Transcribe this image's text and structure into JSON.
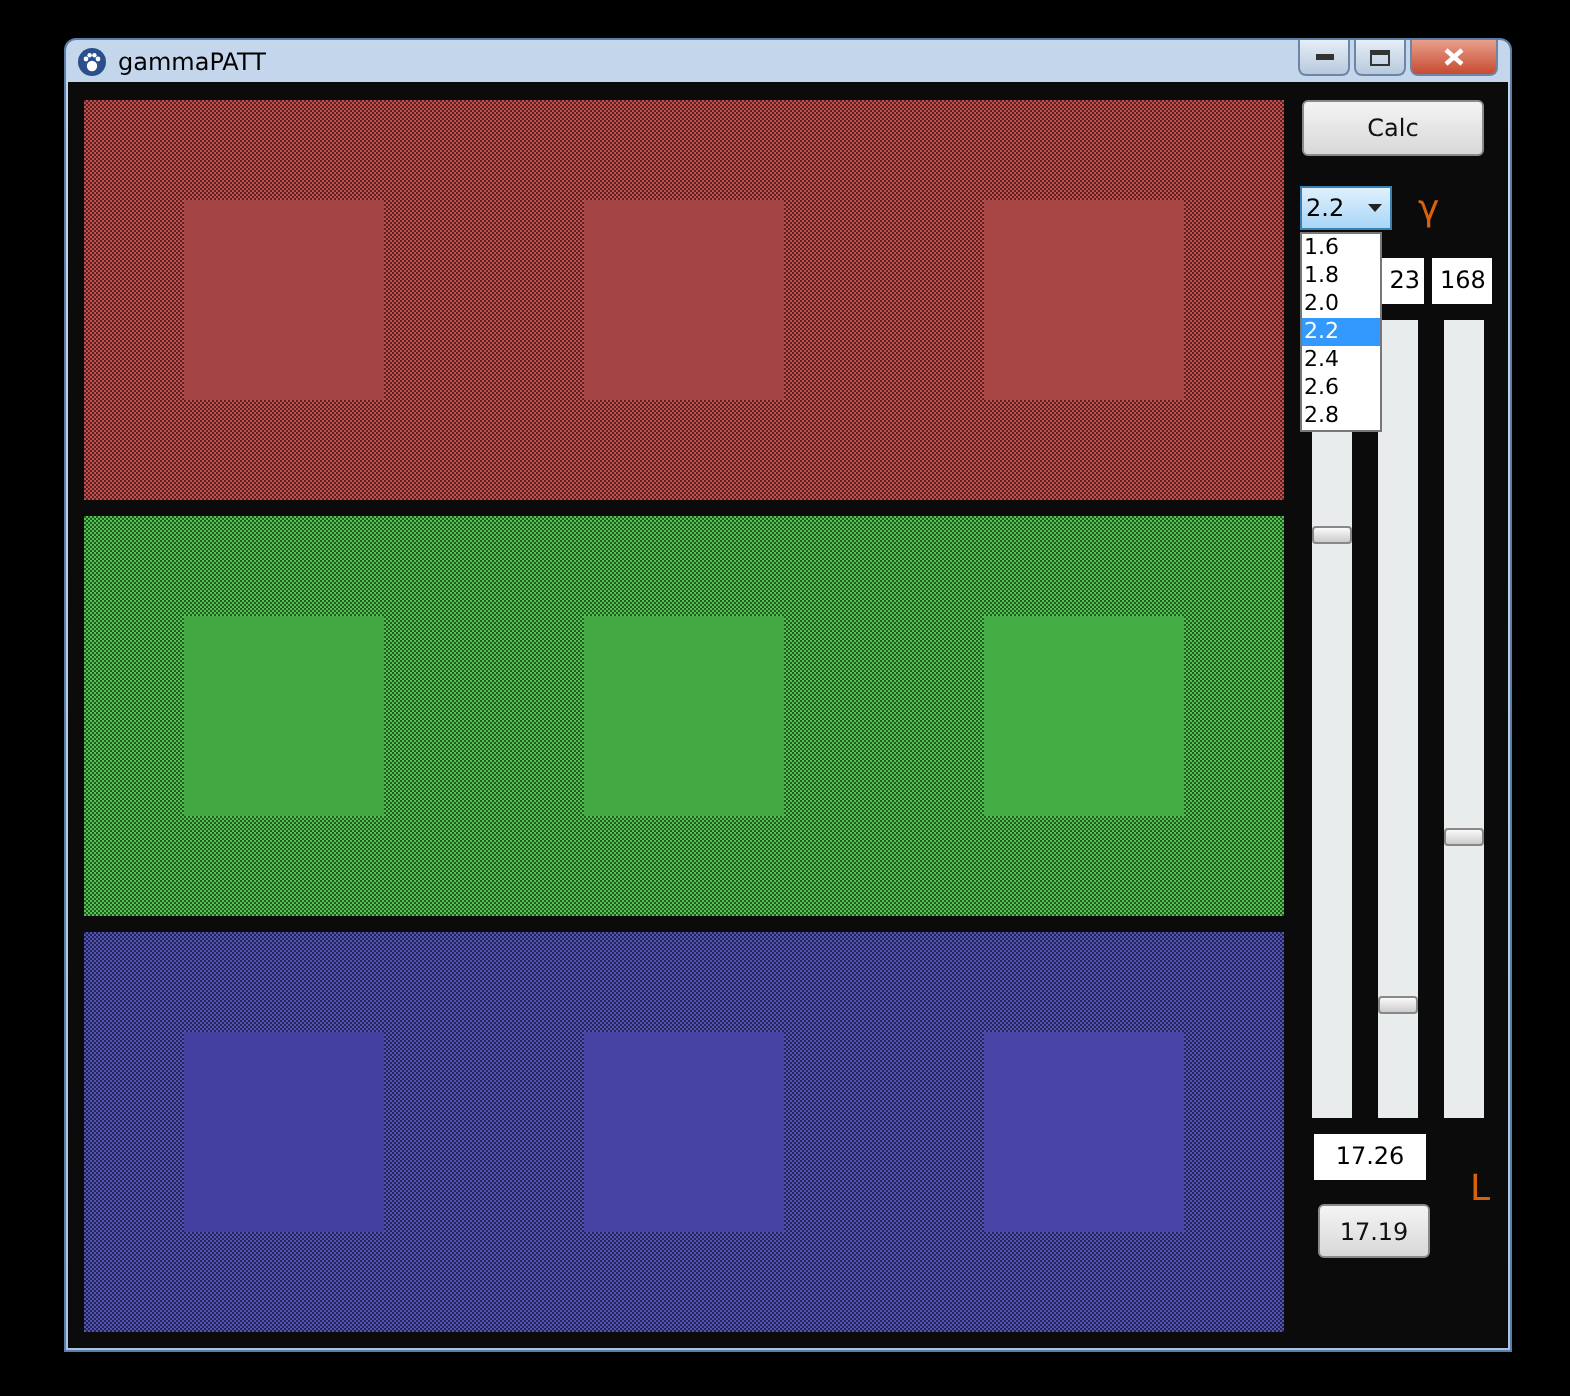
{
  "window": {
    "title": "gammaPATT"
  },
  "panels": [
    {
      "color": "#c44e4e",
      "squares": [
        {
          "color": "#a34343"
        },
        {
          "color": "#a54444"
        },
        {
          "color": "#a84545"
        }
      ]
    },
    {
      "color": "#4fc44f",
      "squares": [
        {
          "color": "#42a842"
        },
        {
          "color": "#43aa43"
        },
        {
          "color": "#44ad44"
        }
      ]
    },
    {
      "color": "#5252b8",
      "squares": [
        {
          "color": "#4440a0"
        },
        {
          "color": "#4642a4"
        },
        {
          "color": "#4844a8"
        }
      ]
    }
  ],
  "calc_button": "Calc",
  "gamma": {
    "value": "2.2",
    "expanded": true,
    "options": [
      {
        "label": "1.6",
        "selected": false
      },
      {
        "label": "1.8",
        "selected": false
      },
      {
        "label": "2.0",
        "selected": false
      },
      {
        "label": "2.2",
        "selected": true
      },
      {
        "label": "2.4",
        "selected": false
      },
      {
        "label": "2.6",
        "selected": false
      },
      {
        "label": "2.8",
        "selected": false
      }
    ]
  },
  "gamma_symbol": "γ",
  "channels": [
    {
      "level": 0.73
    },
    {
      "value": "23",
      "level": 0.14
    },
    {
      "value": "168",
      "level": 0.35
    }
  ],
  "luminance_field": "17.26",
  "luminance_symbol": "L",
  "result_button": "17.19"
}
